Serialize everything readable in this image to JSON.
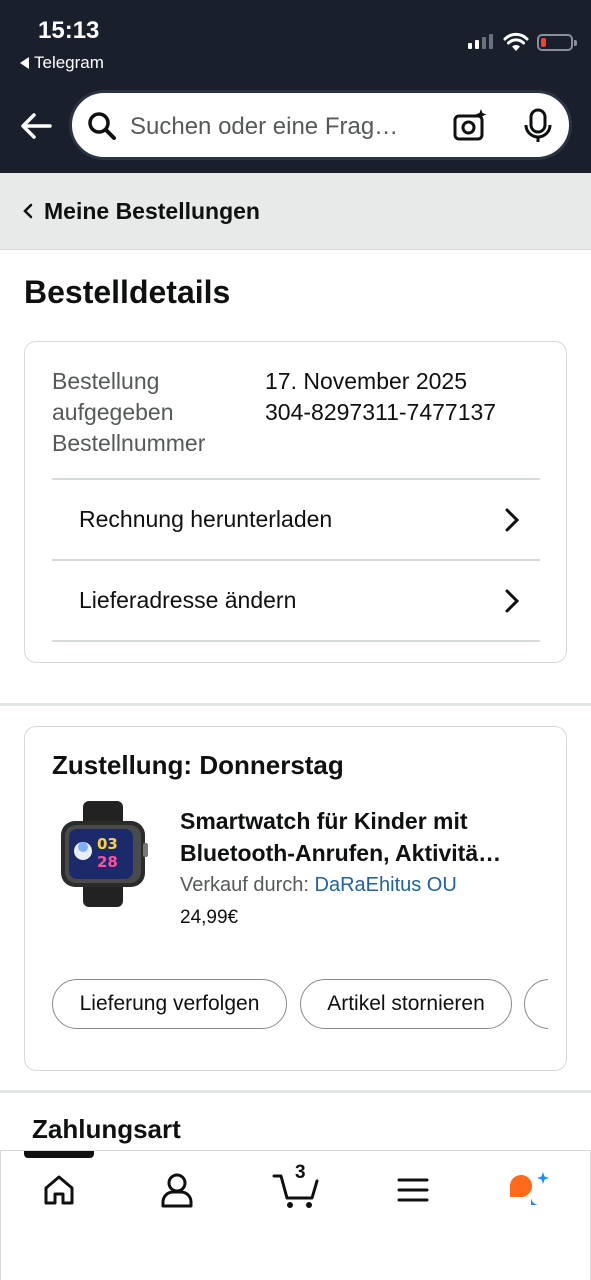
{
  "status_bar": {
    "time": "15:13",
    "back_app": "Telegram"
  },
  "header": {
    "search_placeholder": "Suchen oder eine Frag…"
  },
  "breadcrumb": {
    "label": "Meine Bestellungen"
  },
  "page": {
    "title": "Bestelldetails"
  },
  "order": {
    "label_line1": "Bestellung",
    "label_line2": "aufgegeben",
    "label_line3": "Bestellnummer",
    "date": "17. November 2025",
    "number": "304-8297311-7477137",
    "links": [
      {
        "label": "Rechnung herunterladen"
      },
      {
        "label": "Lieferadresse ändern"
      }
    ]
  },
  "delivery": {
    "title": "Zustellung: Donnerstag",
    "product": {
      "title_line1": "Smartwatch für Kinder mit",
      "title_line2": "Bluetooth-Anrufen, Aktivitä…",
      "seller_prefix": "Verkauf durch:",
      "seller_name": "DaRaEhitus OU",
      "price": "24,99€",
      "thumb_display_1": "03",
      "thumb_display_2": "28"
    },
    "actions": [
      {
        "label": "Lieferung verfolgen"
      },
      {
        "label": "Artikel stornieren"
      },
      {
        "label": ""
      }
    ]
  },
  "payment": {
    "title": "Zahlungsart"
  },
  "tabbar": {
    "cart_count": "3",
    "items": [
      "home",
      "account",
      "cart",
      "menu",
      "assistant"
    ]
  },
  "colors": {
    "header_bg": "#1a1f2c",
    "link": "#2162a1",
    "battery_low": "#ff3b30",
    "assistant_orange": "#ff6a1a",
    "assistant_blue": "#1a8cff"
  }
}
